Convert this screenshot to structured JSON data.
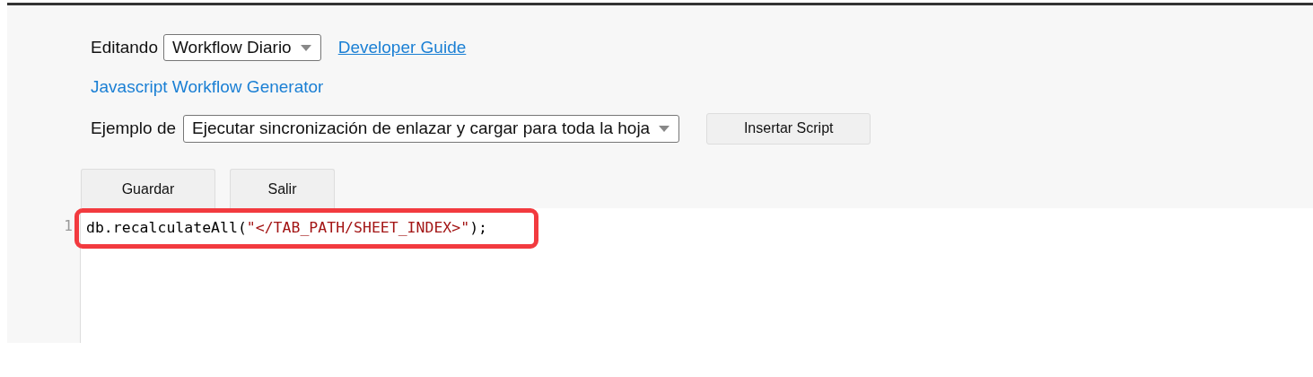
{
  "editing": {
    "label": "Editando",
    "select_value": "Workflow Diario",
    "guide_link": "Developer Guide"
  },
  "generator_link": "Javascript Workflow Generator",
  "example": {
    "label": "Ejemplo de",
    "select_value": "Ejecutar sincronización de enlazar y cargar para toda la hoja",
    "insert_button": "Insertar Script"
  },
  "buttons": [
    "Guardar",
    "Salir"
  ],
  "editor": {
    "lines": [
      {
        "number": "1",
        "highlighted": true,
        "tokens": [
          {
            "kind": "plain",
            "text": "db.recalculateAll("
          },
          {
            "kind": "string",
            "text": "\"</TAB_PATH/SHEET_INDEX>\""
          },
          {
            "kind": "plain",
            "text": ");"
          }
        ]
      }
    ]
  }
}
